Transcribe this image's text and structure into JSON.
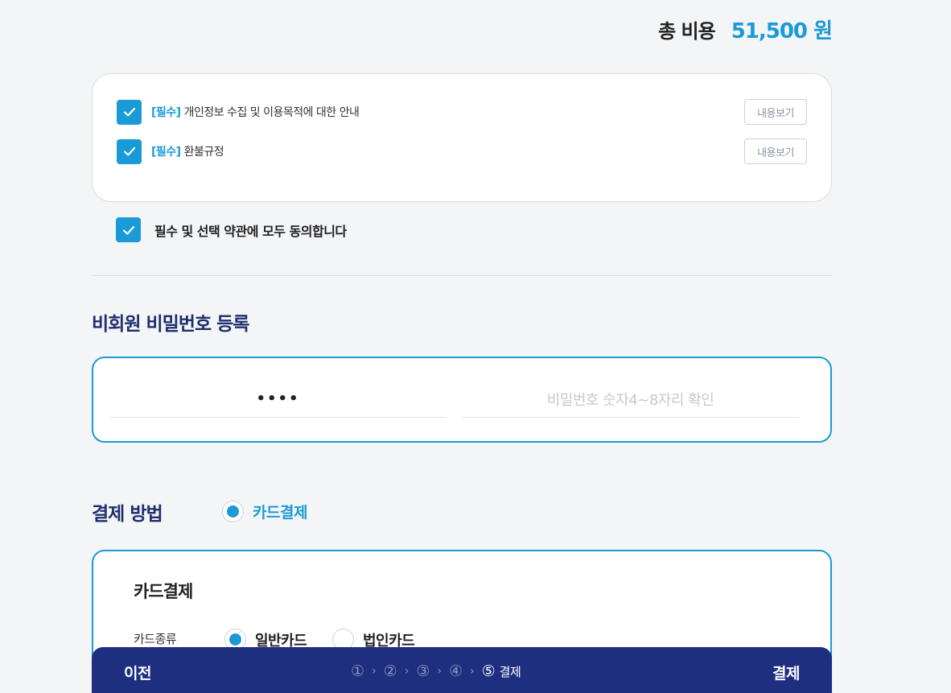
{
  "total": {
    "label": "총 비용",
    "amount": "51,500 원"
  },
  "terms": [
    {
      "tag": "[필수]",
      "text": "개인정보 수집 및 이용목적에 대한 안내",
      "view_label": "내용보기",
      "checked": true
    },
    {
      "tag": "[필수]",
      "text": "환불규정",
      "view_label": "내용보기",
      "checked": true
    }
  ],
  "agree_all": {
    "label": "필수 및 선택 약관에 모두 동의합니다",
    "checked": true
  },
  "password_section": {
    "title": "비회원 비밀번호 등록",
    "password_value": "••••",
    "confirm_placeholder": "비밀번호 숫자4~8자리 확인"
  },
  "payment": {
    "title": "결제 방법",
    "method_label": "카드결제",
    "card_box_title": "카드결제",
    "card_type_label": "카드종류",
    "card_options": [
      {
        "label": "일반카드",
        "selected": true
      },
      {
        "label": "법인카드",
        "selected": false
      }
    ]
  },
  "bottom_bar": {
    "prev_label": "이전",
    "next_label": "결제",
    "steps": [
      "①",
      "②",
      "③",
      "④",
      "⑤"
    ],
    "active_step_label": "결제",
    "separator": "›"
  },
  "colors": {
    "accent": "#1a9ad6",
    "navy": "#1e2f80",
    "title": "#1e2f6e"
  }
}
